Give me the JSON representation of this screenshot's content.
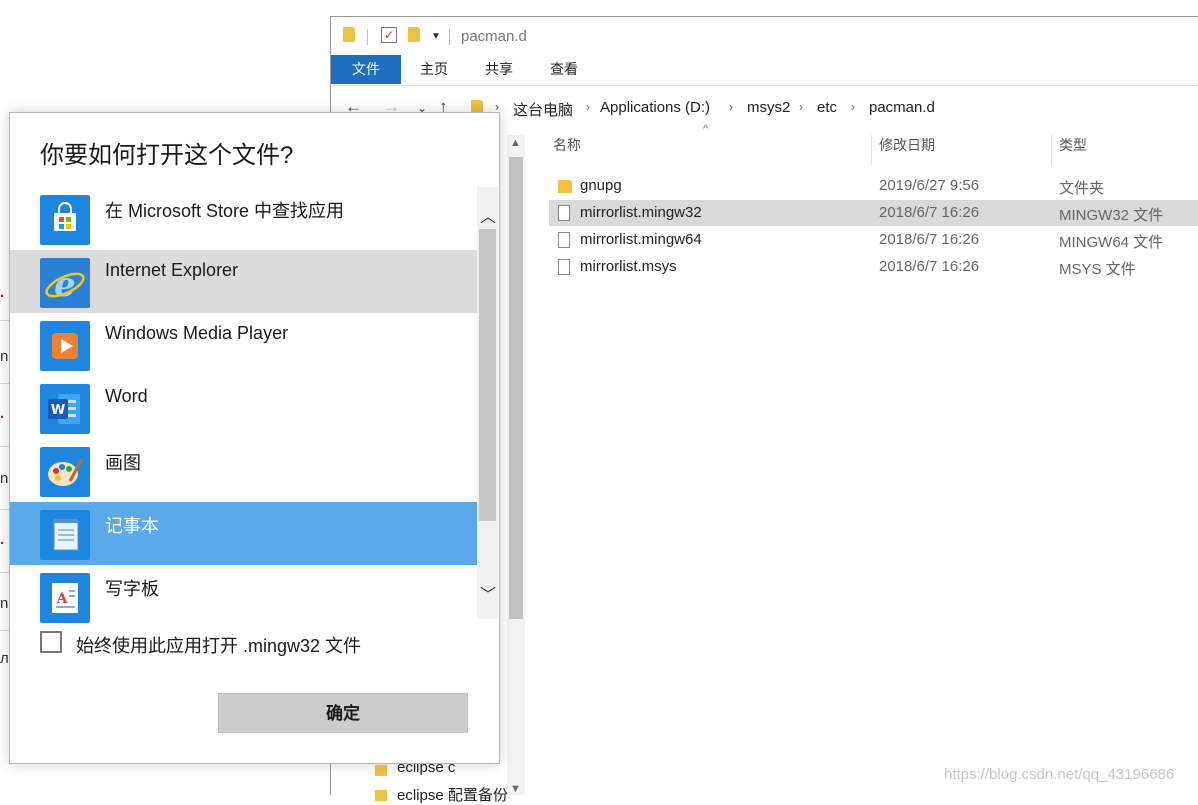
{
  "background_page": {
    "fragments": [
      {
        "text": ".",
        "red": true
      },
      {
        "text": "n",
        "red": false
      },
      {
        "text": ".",
        "red": true
      },
      {
        "text": "n",
        "red": false
      },
      {
        "text": ".",
        "red": true
      },
      {
        "text": "n",
        "red": false
      },
      {
        "text": "л",
        "red": false
      }
    ]
  },
  "explorer": {
    "window_title": "pacman.d",
    "ribbon_tabs": [
      "文件",
      "主页",
      "共享",
      "查看"
    ],
    "breadcrumb": [
      "这台电脑",
      "Applications (D:)",
      "msys2",
      "etc",
      "pacman.d"
    ],
    "columns": {
      "name": "名称",
      "date": "修改日期",
      "type": "类型"
    },
    "files": [
      {
        "name": "gnupg",
        "date": "2019/6/27 9:56",
        "type": "文件夹",
        "kind": "folder",
        "selected": false
      },
      {
        "name": "mirrorlist.mingw32",
        "date": "2018/6/7 16:26",
        "type": "MINGW32 文件",
        "kind": "file",
        "selected": true
      },
      {
        "name": "mirrorlist.mingw64",
        "date": "2018/6/7 16:26",
        "type": "MINGW64 文件",
        "kind": "file",
        "selected": false
      },
      {
        "name": "mirrorlist.msys",
        "date": "2018/6/7 16:26",
        "type": "MSYS 文件",
        "kind": "file",
        "selected": false
      }
    ],
    "tree_items": [
      "eclipse c",
      "eclipse 配置备份"
    ]
  },
  "dialog": {
    "title": "你要如何打开这个文件?",
    "apps": [
      {
        "label": "在 Microsoft Store 中查找应用",
        "icon": "store-icon",
        "state": "normal"
      },
      {
        "label": "Internet Explorer",
        "icon": "internet-explorer-icon",
        "state": "hover"
      },
      {
        "label": "Windows Media Player",
        "icon": "media-player-icon",
        "state": "normal"
      },
      {
        "label": "Word",
        "icon": "word-icon",
        "state": "normal"
      },
      {
        "label": "画图",
        "icon": "paint-icon",
        "state": "normal"
      },
      {
        "label": "记事本",
        "icon": "notepad-icon",
        "state": "selected"
      },
      {
        "label": "写字板",
        "icon": "wordpad-icon",
        "state": "normal"
      }
    ],
    "always_use_label": "始终使用此应用打开 .mingw32 文件",
    "always_use_checked": false,
    "ok_label": "确定"
  },
  "watermark": "https://blog.csdn.net/qq_43196686",
  "colors": {
    "accent": "#1e6fc0",
    "selected_row": "#5aa9eb",
    "hover_row": "#dcdcdc"
  }
}
